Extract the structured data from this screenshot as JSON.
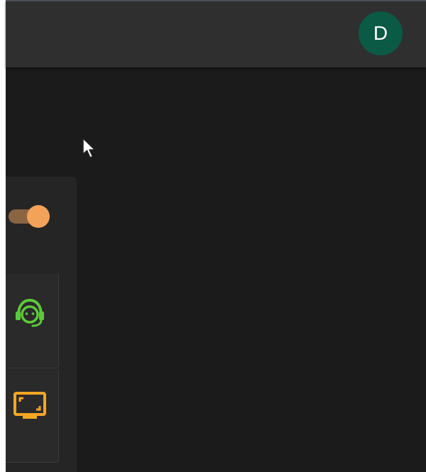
{
  "header": {
    "avatar_initial": "D",
    "avatar_color": "#0b5a46",
    "background": "#2f2f2f"
  },
  "panel": {
    "toggle": {
      "state": "on",
      "track_color": "#8a6542",
      "knob_color": "#f4a259"
    },
    "items": [
      {
        "icon": "headset-support-icon",
        "color": "#5cc93a"
      },
      {
        "icon": "fullscreen-monitor-icon",
        "color": "#f5a623"
      }
    ]
  },
  "pointer": {
    "icon": "mouse-cursor-icon"
  }
}
